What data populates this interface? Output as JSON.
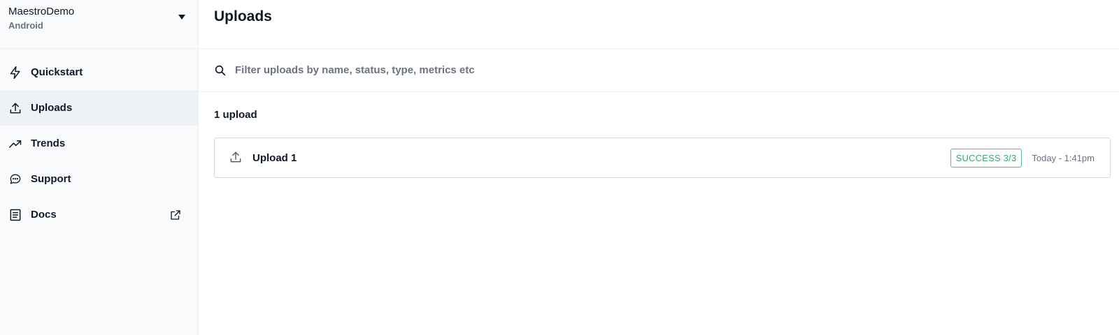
{
  "project": {
    "name": "MaestroDemo",
    "platform": "Android"
  },
  "sidebar": {
    "items": [
      {
        "label": "Quickstart",
        "icon": "bolt-icon"
      },
      {
        "label": "Uploads",
        "icon": "upload-icon",
        "active": true
      },
      {
        "label": "Trends",
        "icon": "trending-up-icon"
      },
      {
        "label": "Support",
        "icon": "chat-bubble-icon"
      },
      {
        "label": "Docs",
        "icon": "document-icon",
        "external": true
      }
    ]
  },
  "header": {
    "title": "Uploads"
  },
  "search": {
    "placeholder": "Filter uploads by name, status, type, metrics etc",
    "value": ""
  },
  "uploads": {
    "count_label": "1 upload",
    "items": [
      {
        "name": "Upload 1",
        "status": "SUCCESS 3/3",
        "timestamp": "Today - 1:41pm"
      }
    ]
  },
  "colors": {
    "success": "#3aa86f",
    "sidebar_bg": "#f9fafb",
    "active_bg": "#eef2f6"
  }
}
